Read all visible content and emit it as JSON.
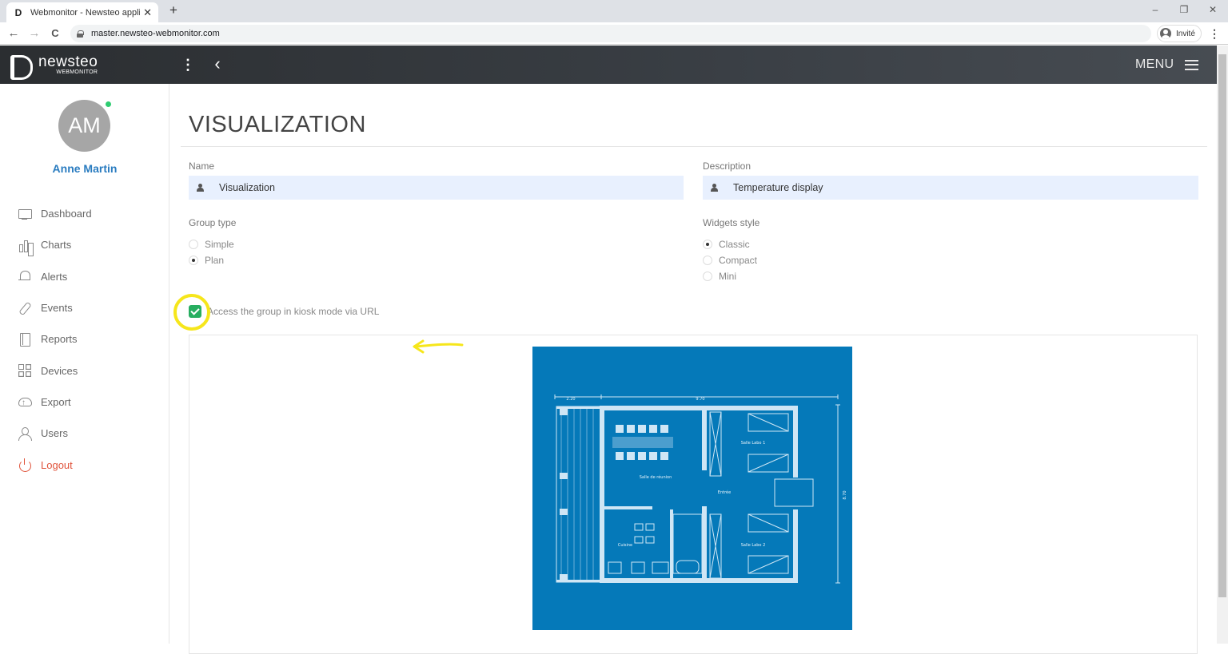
{
  "browser": {
    "tab_title": "Webmonitor - Newsteo applicati",
    "tab_favicon": "D",
    "close_tab": "✕",
    "new_tab": "+",
    "minimize": "–",
    "restore": "❐",
    "close": "✕",
    "back": "←",
    "forward": "→",
    "reload": "C",
    "url": "master.newsteo-webmonitor.com",
    "profile_label": "Invité",
    "menu": "⋮"
  },
  "header": {
    "logo_name": "newsteo",
    "logo_sub": "WEBMONITOR",
    "dots": "⋮",
    "back": "‹",
    "menu_label": "MENU"
  },
  "user": {
    "initials": "AM",
    "name": "Anne Martin",
    "status_color": "#2ecc71"
  },
  "nav": [
    {
      "label": "Dashboard",
      "icon": "monitor-icon"
    },
    {
      "label": "Charts",
      "icon": "bar-chart-icon"
    },
    {
      "label": "Alerts",
      "icon": "bell-icon"
    },
    {
      "label": "Events",
      "icon": "paperclip-icon"
    },
    {
      "label": "Reports",
      "icon": "report-icon"
    },
    {
      "label": "Devices",
      "icon": "grid-icon"
    },
    {
      "label": "Export",
      "icon": "cloud-upload-icon"
    },
    {
      "label": "Users",
      "icon": "user-icon"
    },
    {
      "label": "Logout",
      "icon": "power-icon"
    }
  ],
  "page": {
    "title": "VISUALIZATION",
    "name_label": "Name",
    "name_value": "Visualization",
    "description_label": "Description",
    "description_value": "Temperature display",
    "group_type_label": "Group type",
    "group_type_options": [
      "Simple",
      "Plan"
    ],
    "group_type_selected": "Plan",
    "widgets_style_label": "Widgets style",
    "widgets_style_options": [
      "Classic",
      "Compact",
      "Mini"
    ],
    "widgets_style_selected": "Classic",
    "kiosk_label": "Access the group in kiosk mode via URL",
    "kiosk_checked": true
  },
  "plan": {
    "dim_top_left": "2.20",
    "dim_top_right": "9.70",
    "dim_right": "8.70",
    "rooms": [
      "Salle Labo 1",
      "Salle de réunion",
      "Entrée",
      "Cuisine",
      "Salle Labo 2"
    ],
    "background_color": "#0579b9"
  },
  "colors": {
    "accent_blue": "#2a7cc0",
    "logout_red": "#e0533b",
    "highlight_yellow": "#f6e61b",
    "check_green": "#27ae60"
  }
}
